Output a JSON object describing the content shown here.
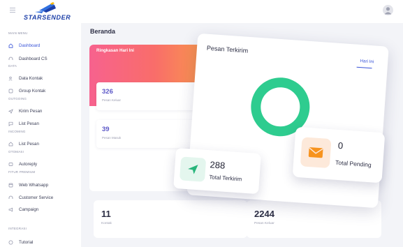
{
  "brand": {
    "logo_text": "STARSENDER",
    "accent": "#3752d8",
    "logo_blue": "#1c3fa8"
  },
  "sidebar": {
    "main_menu": "MAIN MENU",
    "dashboard": "Dashboard",
    "dashboard_cs": "Dashboard CS",
    "data": "DATA",
    "data_kontak": "Data Kontak",
    "group_kontak": "Group Kontak",
    "outgoing": "OUTGOING",
    "kirim_pesan": "Kirim Pesan",
    "list_pesan_out": "List Pesan",
    "incoming": "INCOMING",
    "list_pesan_in": "List Pesan",
    "otomasi": "OTOMASI",
    "autoreply": "Autoreply",
    "fitur_premium": "FITUR PREMIUM",
    "web_whatsapp": "Web Whatsapp",
    "customer_service": "Customer Service",
    "campaign": "Campaign",
    "integrasi": "INTEGRASI",
    "tutorial": "Tutorial"
  },
  "page": {
    "title": "Beranda"
  },
  "summary": {
    "title": "Ringkasan Hari Ini",
    "pesan_keluar_value": "326",
    "pesan_keluar_label": "Pesan Keluar",
    "pesan_masuk_value": "39",
    "pesan_masuk_label": "Pesan Masuk"
  },
  "stats": {
    "kontak_value": "11",
    "kontak_label": "Kontak",
    "keluar_value": "2244",
    "keluar_label": "Pesan Keluar"
  },
  "sent_panel": {
    "title": "Pesan Terkirim",
    "tab": "Hari Ini",
    "donut_color": "#2ecc8f"
  },
  "total_sent": {
    "value": "288",
    "label": "Total Terkirim",
    "color": "#27b57b"
  },
  "total_pending": {
    "value": "0",
    "label": "Total Pending",
    "color": "#f7931e"
  },
  "chart_data": {
    "type": "pie",
    "title": "Pesan Terkirim",
    "categories": [
      "Total Terkirim",
      "Total Pending"
    ],
    "values": [
      288,
      0
    ]
  }
}
